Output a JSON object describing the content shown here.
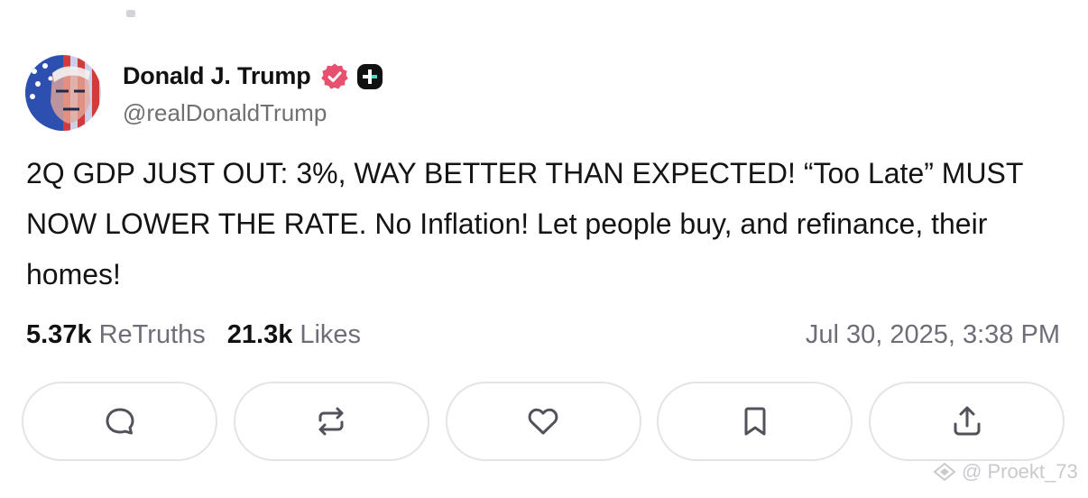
{
  "author": {
    "display_name": "Donald J. Trump",
    "handle": "@realDonaldTrump",
    "verified_icon": "verified-badge-icon",
    "plus_icon": "plus-badge-icon"
  },
  "post": {
    "text": "2Q GDP JUST OUT: 3%, WAY BETTER THAN EXPECTED! “Too Late” MUST NOW LOWER THE RATE. No Inflation! Let people buy, and refinance, their homes!"
  },
  "stats": {
    "retruths_count": "5.37k",
    "retruths_label": "ReTruths",
    "likes_count": "21.3k",
    "likes_label": "Likes",
    "timestamp": "Jul 30, 2025, 3:38 PM"
  },
  "actions": [
    {
      "name": "reply",
      "icon": "reply-icon"
    },
    {
      "name": "retruth",
      "icon": "retruth-icon"
    },
    {
      "name": "like",
      "icon": "heart-icon"
    },
    {
      "name": "bookmark",
      "icon": "bookmark-icon"
    },
    {
      "name": "share",
      "icon": "share-icon"
    }
  ],
  "watermark": {
    "text": "@ Proekt_73"
  },
  "colors": {
    "verified_badge": "#e8506e",
    "plus_badge": "#111111",
    "plus_accent": "#4ddbc4",
    "muted_text": "#6e6e78",
    "button_border": "#e4e4e7",
    "icon_stroke": "#52525b"
  }
}
